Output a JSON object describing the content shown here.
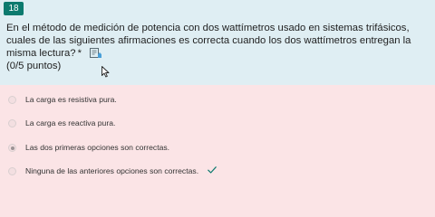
{
  "question": {
    "number": "18",
    "text": "En el método de medición de potencia con dos wattímetros usado en sistemas trifásicos, cuales de las siguientes afirmaciones es correcta cuando los dos wattímetros entregan la misma lectura?",
    "required_marker": "*",
    "points": "(0/5 puntos)"
  },
  "options": [
    {
      "label": "La carga es resistiva pura.",
      "selected": false,
      "correct": false
    },
    {
      "label": "La carga es reactiva pura.",
      "selected": false,
      "correct": false
    },
    {
      "label": "Las dos primeras opciones son correctas.",
      "selected": true,
      "correct": false
    },
    {
      "label": "Ninguna de las anteriores opciones son correctas.",
      "selected": false,
      "correct": true
    }
  ],
  "colors": {
    "question_background": "#dfeef3",
    "answer_background": "#fbe4e6",
    "number_badge": "#0c7a6e",
    "correct_check": "#0c7a6e"
  },
  "icons": {
    "immersive_reader": "immersive-reader-icon",
    "correct": "checkmark-icon",
    "cursor": "mouse-cursor-icon"
  }
}
